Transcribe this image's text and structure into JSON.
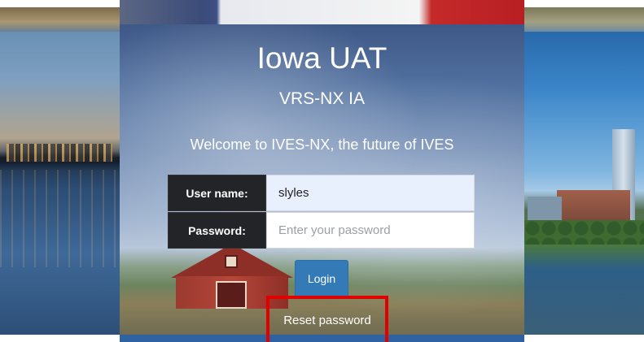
{
  "header": {
    "title": "Iowa UAT",
    "subtitle": "VRS-NX IA",
    "welcome": "Welcome to IVES-NX, the future of IVES"
  },
  "form": {
    "username_label": "User name:",
    "username_value": "slyles",
    "password_label": "Password:",
    "password_placeholder": "Enter your password",
    "login_label": "Login",
    "reset_label": "Reset password"
  },
  "colors": {
    "login_button": "#337ab7",
    "label_background": "#222428",
    "highlight_box": "#e00000"
  }
}
